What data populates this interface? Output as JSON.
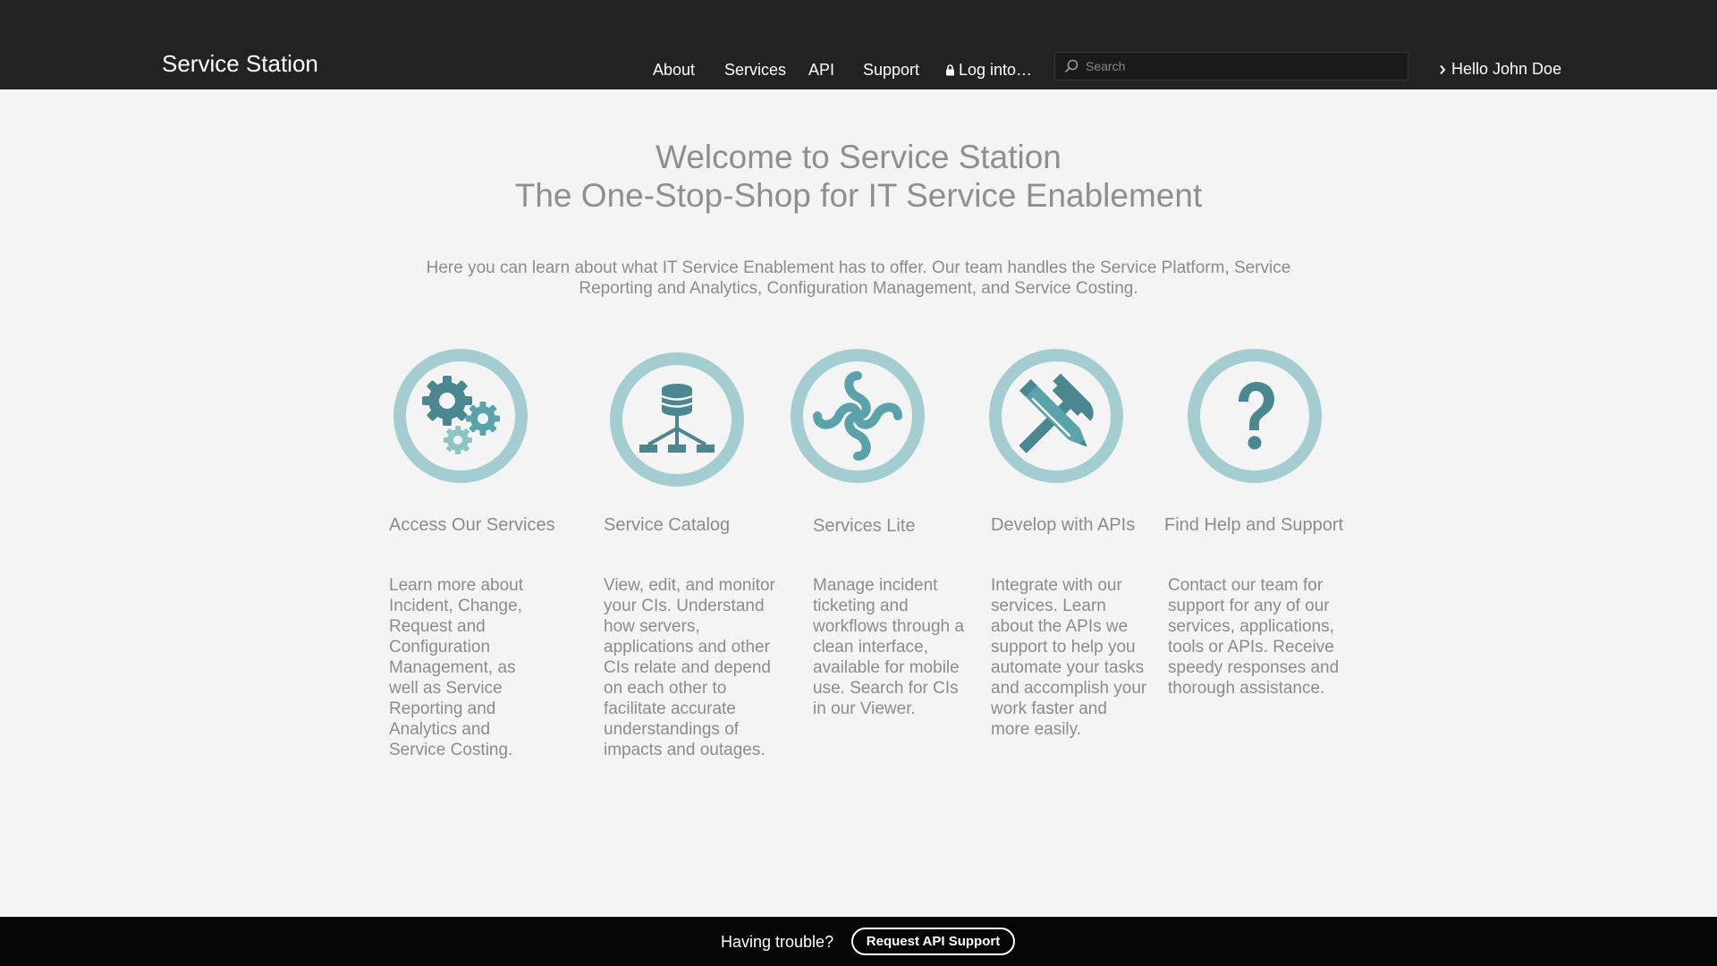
{
  "header": {
    "brand": "Service Station",
    "nav": {
      "about": "About",
      "services": "Services",
      "api": "API",
      "support": "Support",
      "login": "Log into…"
    },
    "search_placeholder": "Search",
    "user_greeting": "Hello John Doe"
  },
  "hero": {
    "title_line1": "Welcome to Service Station",
    "title_line2": "The One-Stop-Shop for IT Service Enablement",
    "description": "Here you can learn about what IT Service Enablement has to offer. Our team handles the Service Platform, Service Reporting and Analytics, Configuration Management, and Service Costing."
  },
  "cards": [
    {
      "icon": "gears-icon",
      "title": "Access Our Services",
      "description": "Learn more about Incident, Change, Request and Configuration Management, as well as Service Reporting and Analytics and Service Costing."
    },
    {
      "icon": "database-hierarchy-icon",
      "title": "Service Catalog",
      "description": "View, edit, and monitor your CIs. Understand how servers, applications and other CIs relate and depend on each other to facilitate accurate understandings of impacts and outages."
    },
    {
      "icon": "flow-cross-icon",
      "title": "Services Lite",
      "description": "Manage incident ticketing and workflows through a clean interface, available for mobile use. Search for CIs in our Viewer."
    },
    {
      "icon": "hammer-pencil-icon",
      "title": "Develop with APIs",
      "description": "Integrate with our services. Learn about the APIs we support to help you automate your tasks and accomplish your work faster and more easily."
    },
    {
      "icon": "question-mark-icon",
      "title": "Find Help and Support",
      "description": "Contact our team for support for any of our services, applications, tools or APIs. Receive speedy responses and thorough assistance."
    }
  ],
  "footer": {
    "trouble_text": "Having trouble?",
    "button_label": "Request API Support"
  },
  "colors": {
    "header_bg": "#222222",
    "page_bg": "#f4f4f4",
    "icon_ring": "#a3cdd0",
    "icon_dark": "#4a8791",
    "icon_teal": "#5aa3ab",
    "icon_light": "#8cc4c8",
    "footer_bg": "#050505"
  }
}
